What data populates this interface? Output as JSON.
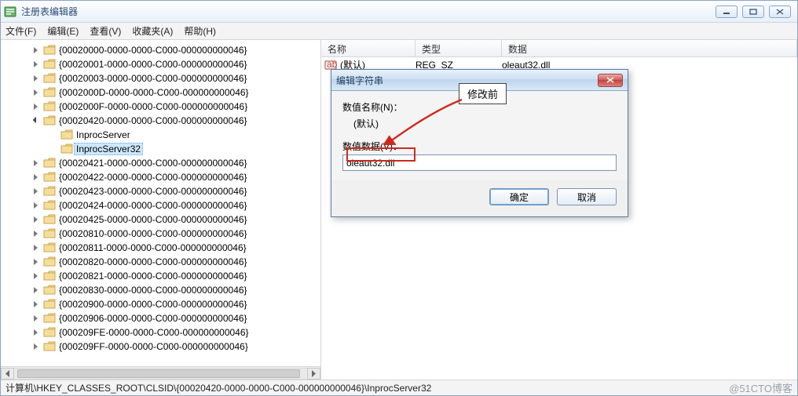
{
  "window": {
    "title": "注册表编辑器"
  },
  "menu": {
    "file": "文件(F)",
    "edit": "编辑(E)",
    "view": "查看(V)",
    "favorites": "收藏夹(A)",
    "help": "帮助(H)"
  },
  "tree": {
    "items": [
      {
        "label": "{00020000-0000-0000-C000-000000000046}",
        "depth": 4,
        "glyph": "collapsed"
      },
      {
        "label": "{00020001-0000-0000-C000-000000000046}",
        "depth": 4,
        "glyph": "collapsed"
      },
      {
        "label": "{00020003-0000-0000-C000-000000000046}",
        "depth": 4,
        "glyph": "collapsed"
      },
      {
        "label": "{0002000D-0000-0000-C000-000000000046}",
        "depth": 4,
        "glyph": "collapsed"
      },
      {
        "label": "{0002000F-0000-0000-C000-000000000046}",
        "depth": 4,
        "glyph": "collapsed"
      },
      {
        "label": "{00020420-0000-0000-C000-000000000046}",
        "depth": 4,
        "glyph": "expanded"
      },
      {
        "label": "InprocServer",
        "depth": 5,
        "glyph": "none"
      },
      {
        "label": "InprocServer32",
        "depth": 5,
        "glyph": "none",
        "selected": true
      },
      {
        "label": "{00020421-0000-0000-C000-000000000046}",
        "depth": 4,
        "glyph": "collapsed"
      },
      {
        "label": "{00020422-0000-0000-C000-000000000046}",
        "depth": 4,
        "glyph": "collapsed"
      },
      {
        "label": "{00020423-0000-0000-C000-000000000046}",
        "depth": 4,
        "glyph": "collapsed"
      },
      {
        "label": "{00020424-0000-0000-C000-000000000046}",
        "depth": 4,
        "glyph": "collapsed"
      },
      {
        "label": "{00020425-0000-0000-C000-000000000046}",
        "depth": 4,
        "glyph": "collapsed"
      },
      {
        "label": "{00020810-0000-0000-C000-000000000046}",
        "depth": 4,
        "glyph": "collapsed"
      },
      {
        "label": "{00020811-0000-0000-C000-000000000046}",
        "depth": 4,
        "glyph": "collapsed"
      },
      {
        "label": "{00020820-0000-0000-C000-000000000046}",
        "depth": 4,
        "glyph": "collapsed"
      },
      {
        "label": "{00020821-0000-0000-C000-000000000046}",
        "depth": 4,
        "glyph": "collapsed"
      },
      {
        "label": "{00020830-0000-0000-C000-000000000046}",
        "depth": 4,
        "glyph": "collapsed"
      },
      {
        "label": "{00020900-0000-0000-C000-000000000046}",
        "depth": 4,
        "glyph": "collapsed"
      },
      {
        "label": "{00020906-0000-0000-C000-000000000046}",
        "depth": 4,
        "glyph": "collapsed"
      },
      {
        "label": "{000209FE-0000-0000-C000-000000000046}",
        "depth": 4,
        "glyph": "collapsed"
      },
      {
        "label": "{000209FF-0000-0000-C000-000000000046}",
        "depth": 4,
        "glyph": "collapsed"
      }
    ]
  },
  "list": {
    "headers": {
      "name": "名称",
      "type": "类型",
      "data": "数据"
    },
    "rows": [
      {
        "name": "(默认)",
        "type": "REG_SZ",
        "data": "oleaut32.dll"
      }
    ]
  },
  "dialog": {
    "title": "编辑字符串",
    "name_label": "数值名称(N)：",
    "name_value": "(默认)",
    "data_label": "数值数据(V)：",
    "data_value": "oleaut32.dll",
    "ok": "确定",
    "cancel": "取消"
  },
  "annotation": {
    "callout": "修改前"
  },
  "statusbar": {
    "path": "计算机\\HKEY_CLASSES_ROOT\\CLSID\\{00020420-0000-0000-C000-000000000046}\\InprocServer32",
    "watermark": "@51CTO博客"
  }
}
